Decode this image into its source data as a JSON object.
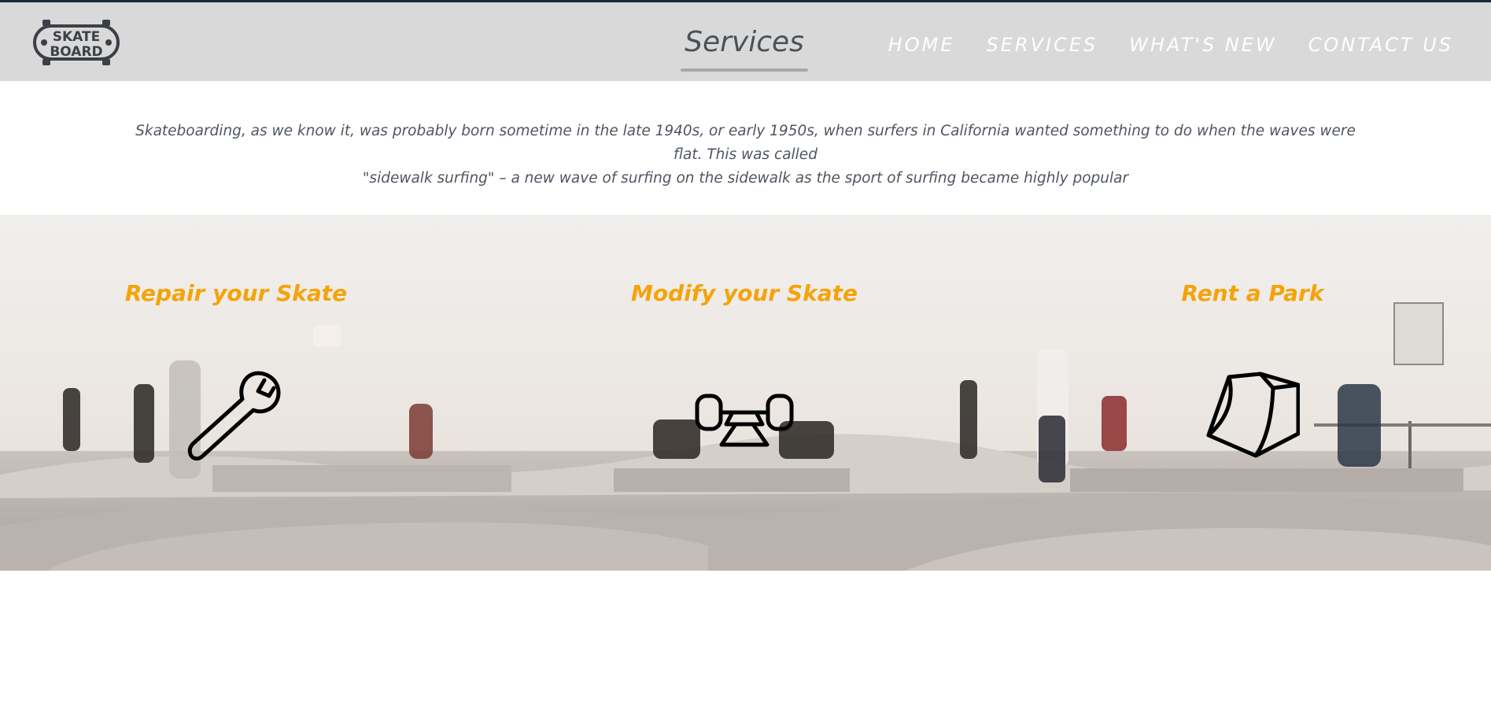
{
  "brand": {
    "logo_line1": "SKATE",
    "logo_line2": "BOARD"
  },
  "header": {
    "page_title": "Services"
  },
  "nav": {
    "items": [
      "HOME",
      "SERVICES",
      "WHAT'S NEW",
      "CONTACT US"
    ]
  },
  "intro": {
    "line1": "Skateboarding, as we know it, was probably born sometime in the late 1940s, or early 1950s, when surfers in California wanted something to do when the waves were flat. This was called",
    "line2": "\"sidewalk surfing\" – a new wave of surfing on the sidewalk as the sport of surfing became highly popular"
  },
  "services": [
    {
      "title": "Repair your Skate",
      "icon": "wrench-icon"
    },
    {
      "title": "Modify your Skate",
      "icon": "skate-truck-icon"
    },
    {
      "title": "Rent a Park",
      "icon": "quarter-pipe-ramp-icon"
    }
  ],
  "colors": {
    "header_bg": "#d9d9d9",
    "accent": "#f5a30a",
    "text": "#4f5661",
    "nav_text": "#ffffff"
  }
}
